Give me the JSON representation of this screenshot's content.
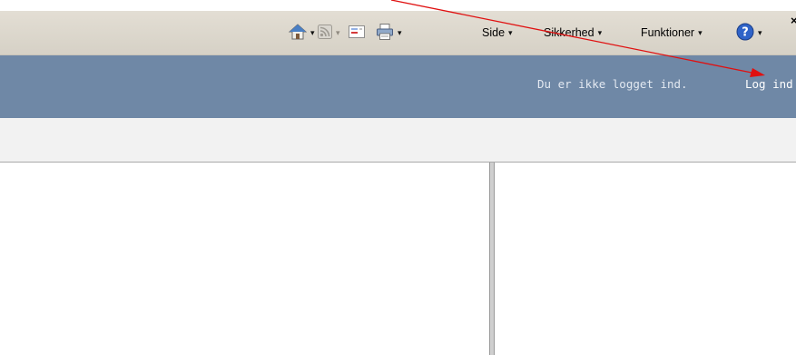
{
  "toolbar": {
    "side_label": "Side",
    "sikkerhed_label": "Sikkerhed",
    "funktioner_label": "Funktioner",
    "icons": [
      "home-icon",
      "rss-feed-icon",
      "read-mail-icon",
      "print-icon",
      "help-icon"
    ],
    "caret": "▾",
    "close": "×"
  },
  "header": {
    "status_text": "Du er ikke logget ind.",
    "login_link": "Log ind"
  },
  "annotation": {
    "color": "#e01010"
  }
}
